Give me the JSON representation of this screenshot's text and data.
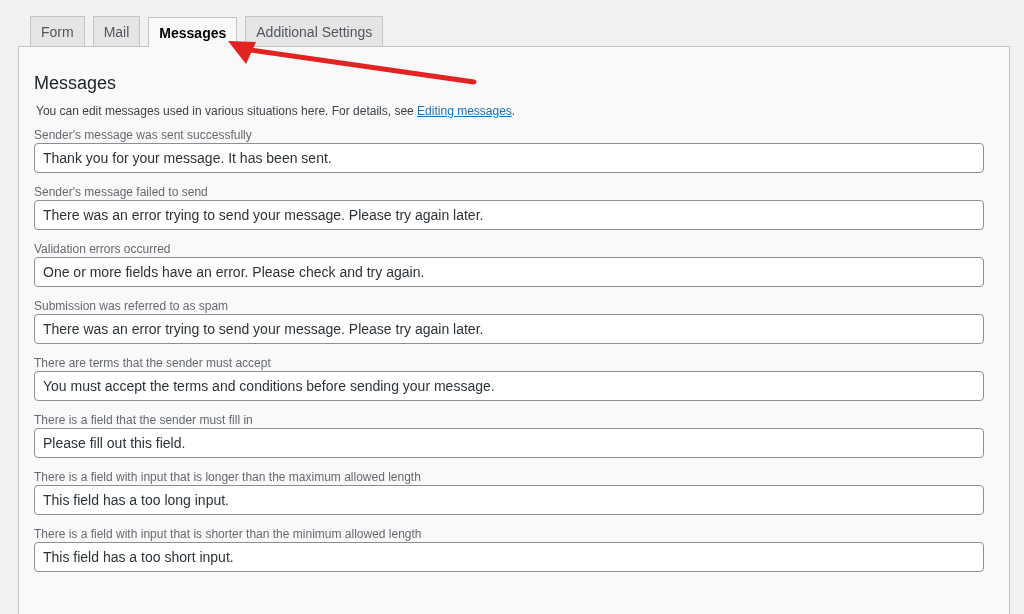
{
  "tabs": [
    {
      "label": "Form",
      "selected": false
    },
    {
      "label": "Mail",
      "selected": false
    },
    {
      "label": "Messages",
      "selected": true
    },
    {
      "label": "Additional Settings",
      "selected": false
    }
  ],
  "panel": {
    "heading": "Messages",
    "description": {
      "before": "You can edit messages used in various situations here. For details, see ",
      "link": "Editing messages",
      "after": "."
    },
    "messages": [
      {
        "label": "Sender's message was sent successfully",
        "value": "Thank you for your message. It has been sent."
      },
      {
        "label": "Sender's message failed to send",
        "value": "There was an error trying to send your message. Please try again later."
      },
      {
        "label": "Validation errors occurred",
        "value": "One or more fields have an error. Please check and try again."
      },
      {
        "label": "Submission was referred to as spam",
        "value": "There was an error trying to send your message. Please try again later."
      },
      {
        "label": "There are terms that the sender must accept",
        "value": "You must accept the terms and conditions before sending your message."
      },
      {
        "label": "There is a field that the sender must fill in",
        "value": "Please fill out this field."
      },
      {
        "label": "There is a field with input that is longer than the maximum allowed length",
        "value": "This field has a too long input."
      },
      {
        "label": "There is a field with input that is shorter than the minimum allowed length",
        "value": "This field has a too short input."
      }
    ]
  }
}
